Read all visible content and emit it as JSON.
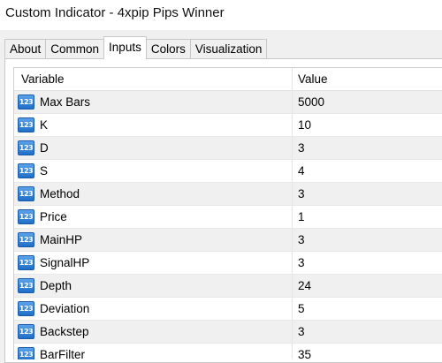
{
  "window": {
    "title": "Custom Indicator - 4xpip Pips Winner"
  },
  "tabs": [
    {
      "label": "About"
    },
    {
      "label": "Common"
    },
    {
      "label": "Inputs"
    },
    {
      "label": "Colors"
    },
    {
      "label": "Visualization"
    }
  ],
  "active_tab": "Inputs",
  "grid": {
    "columns": [
      "Variable",
      "Value"
    ],
    "icon_label": "123",
    "rows": [
      {
        "variable": "Max Bars",
        "value": "5000"
      },
      {
        "variable": "K",
        "value": "10"
      },
      {
        "variable": "D",
        "value": "3"
      },
      {
        "variable": "S",
        "value": "4"
      },
      {
        "variable": "Method",
        "value": "3"
      },
      {
        "variable": "Price",
        "value": "1"
      },
      {
        "variable": "MainHP",
        "value": "3"
      },
      {
        "variable": "SignalHP",
        "value": "3"
      },
      {
        "variable": "Depth",
        "value": "24"
      },
      {
        "variable": "Deviation",
        "value": "5"
      },
      {
        "variable": "Backstep",
        "value": "3"
      },
      {
        "variable": "BarFilter",
        "value": "35"
      }
    ]
  },
  "colors": {
    "icon": "#2a7fd6",
    "row_alt": "#f0f0f0",
    "row": "#ffffff"
  }
}
